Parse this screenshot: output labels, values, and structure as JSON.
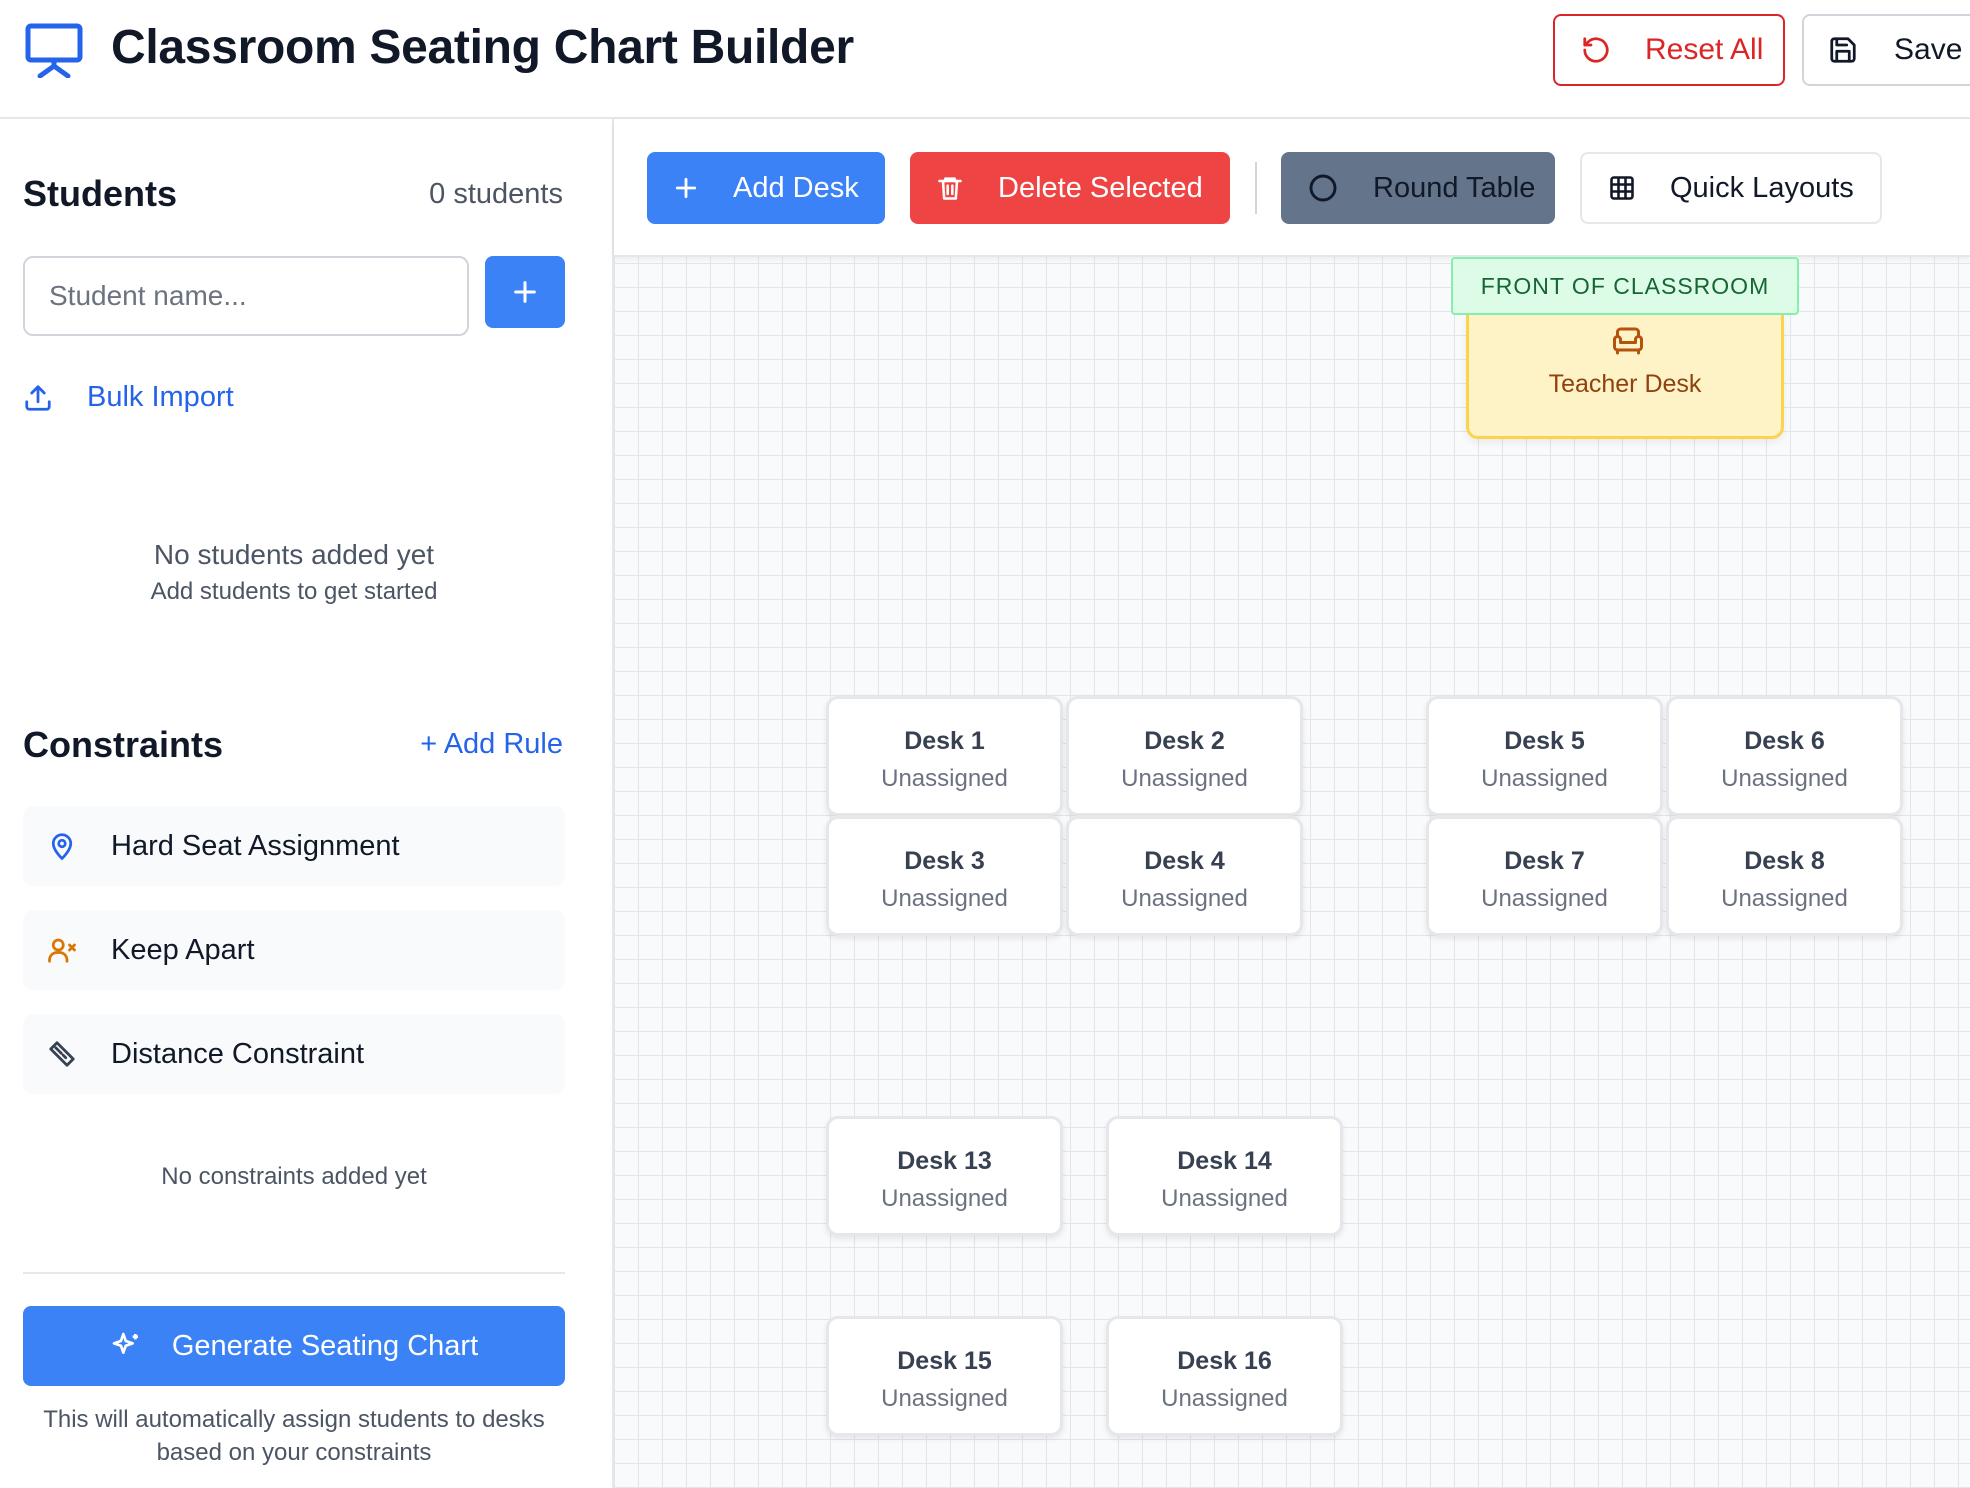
{
  "header": {
    "title": "Classroom Seating Chart Builder",
    "reset_label": "Reset All",
    "save_label": "Save L"
  },
  "sidebar": {
    "students_title": "Students",
    "students_count": "0 students",
    "name_placeholder": "Student name...",
    "bulk_import_label": "Bulk Import",
    "empty_title": "No students added yet",
    "empty_subtitle": "Add students to get started",
    "constraints_title": "Constraints",
    "add_rule_label": "+ Add Rule",
    "rules": [
      {
        "label": "Hard Seat Assignment",
        "icon": "map-pin-icon"
      },
      {
        "label": "Keep Apart",
        "icon": "user-x-icon"
      },
      {
        "label": "Distance Constraint",
        "icon": "ruler-icon"
      }
    ],
    "no_constraints": "No constraints added yet",
    "generate_label": "Generate Seating Chart",
    "generate_hint_line1": "This will automatically assign students to desks",
    "generate_hint_line2": "based on your constraints"
  },
  "toolbar": {
    "add_desk": "Add Desk",
    "delete_selected": "Delete Selected",
    "round_table": "Round Table",
    "quick_layouts": "Quick Layouts"
  },
  "room": {
    "front_label": "FRONT OF CLASSROOM",
    "teacher_desk": "Teacher Desk"
  },
  "desks": [
    {
      "name": "Desk 1",
      "status": "Unassigned"
    },
    {
      "name": "Desk 2",
      "status": "Unassigned"
    },
    {
      "name": "Desk 3",
      "status": "Unassigned"
    },
    {
      "name": "Desk 4",
      "status": "Unassigned"
    },
    {
      "name": "Desk 5",
      "status": "Unassigned"
    },
    {
      "name": "Desk 6",
      "status": "Unassigned"
    },
    {
      "name": "Desk 7",
      "status": "Unassigned"
    },
    {
      "name": "Desk 8",
      "status": "Unassigned"
    },
    {
      "name": "Desk 13",
      "status": "Unassigned"
    },
    {
      "name": "Desk 14",
      "status": "Unassigned"
    },
    {
      "name": "Desk 15",
      "status": "Unassigned"
    },
    {
      "name": "Desk 16",
      "status": "Unassigned"
    }
  ],
  "colors": {
    "primary": "#3b82f6",
    "danger": "#ef4444",
    "slate": "#64748b",
    "teacher_desk_bg": "#fef3c7",
    "front_bg": "#dcfce7"
  }
}
